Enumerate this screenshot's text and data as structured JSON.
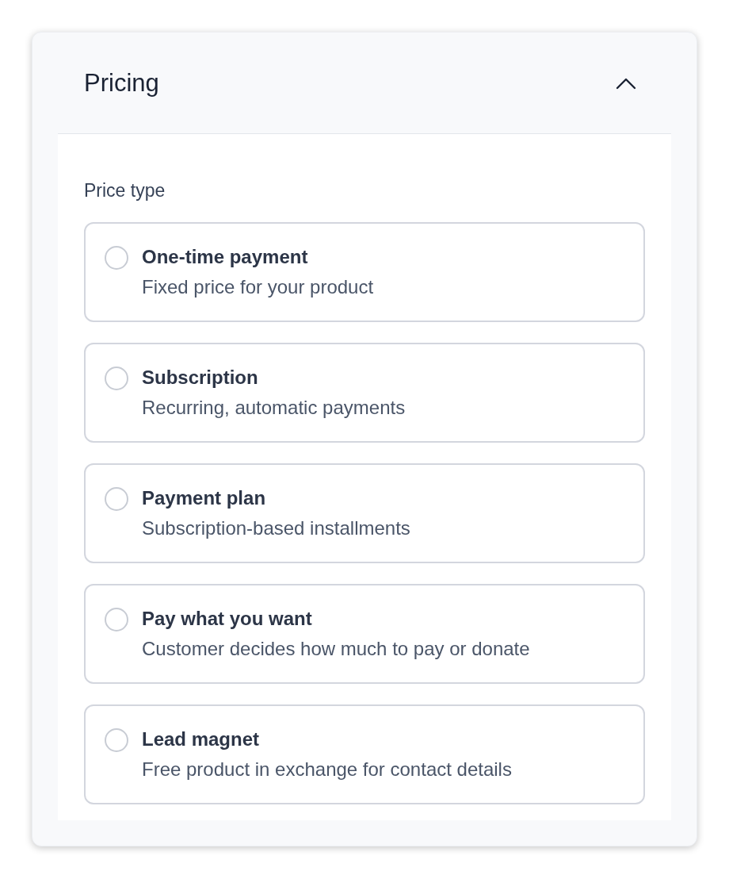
{
  "section": {
    "title": "Pricing",
    "expanded": true
  },
  "price_type": {
    "label": "Price type",
    "options": [
      {
        "title": "One-time payment",
        "description": "Fixed price for your product",
        "selected": false
      },
      {
        "title": "Subscription",
        "description": "Recurring, automatic payments",
        "selected": false
      },
      {
        "title": "Payment plan",
        "description": "Subscription-based installments",
        "selected": false
      },
      {
        "title": "Pay what you want",
        "description": "Customer decides how much to pay or donate",
        "selected": false
      },
      {
        "title": "Lead magnet",
        "description": "Free product in exchange for contact details",
        "selected": false
      }
    ]
  }
}
